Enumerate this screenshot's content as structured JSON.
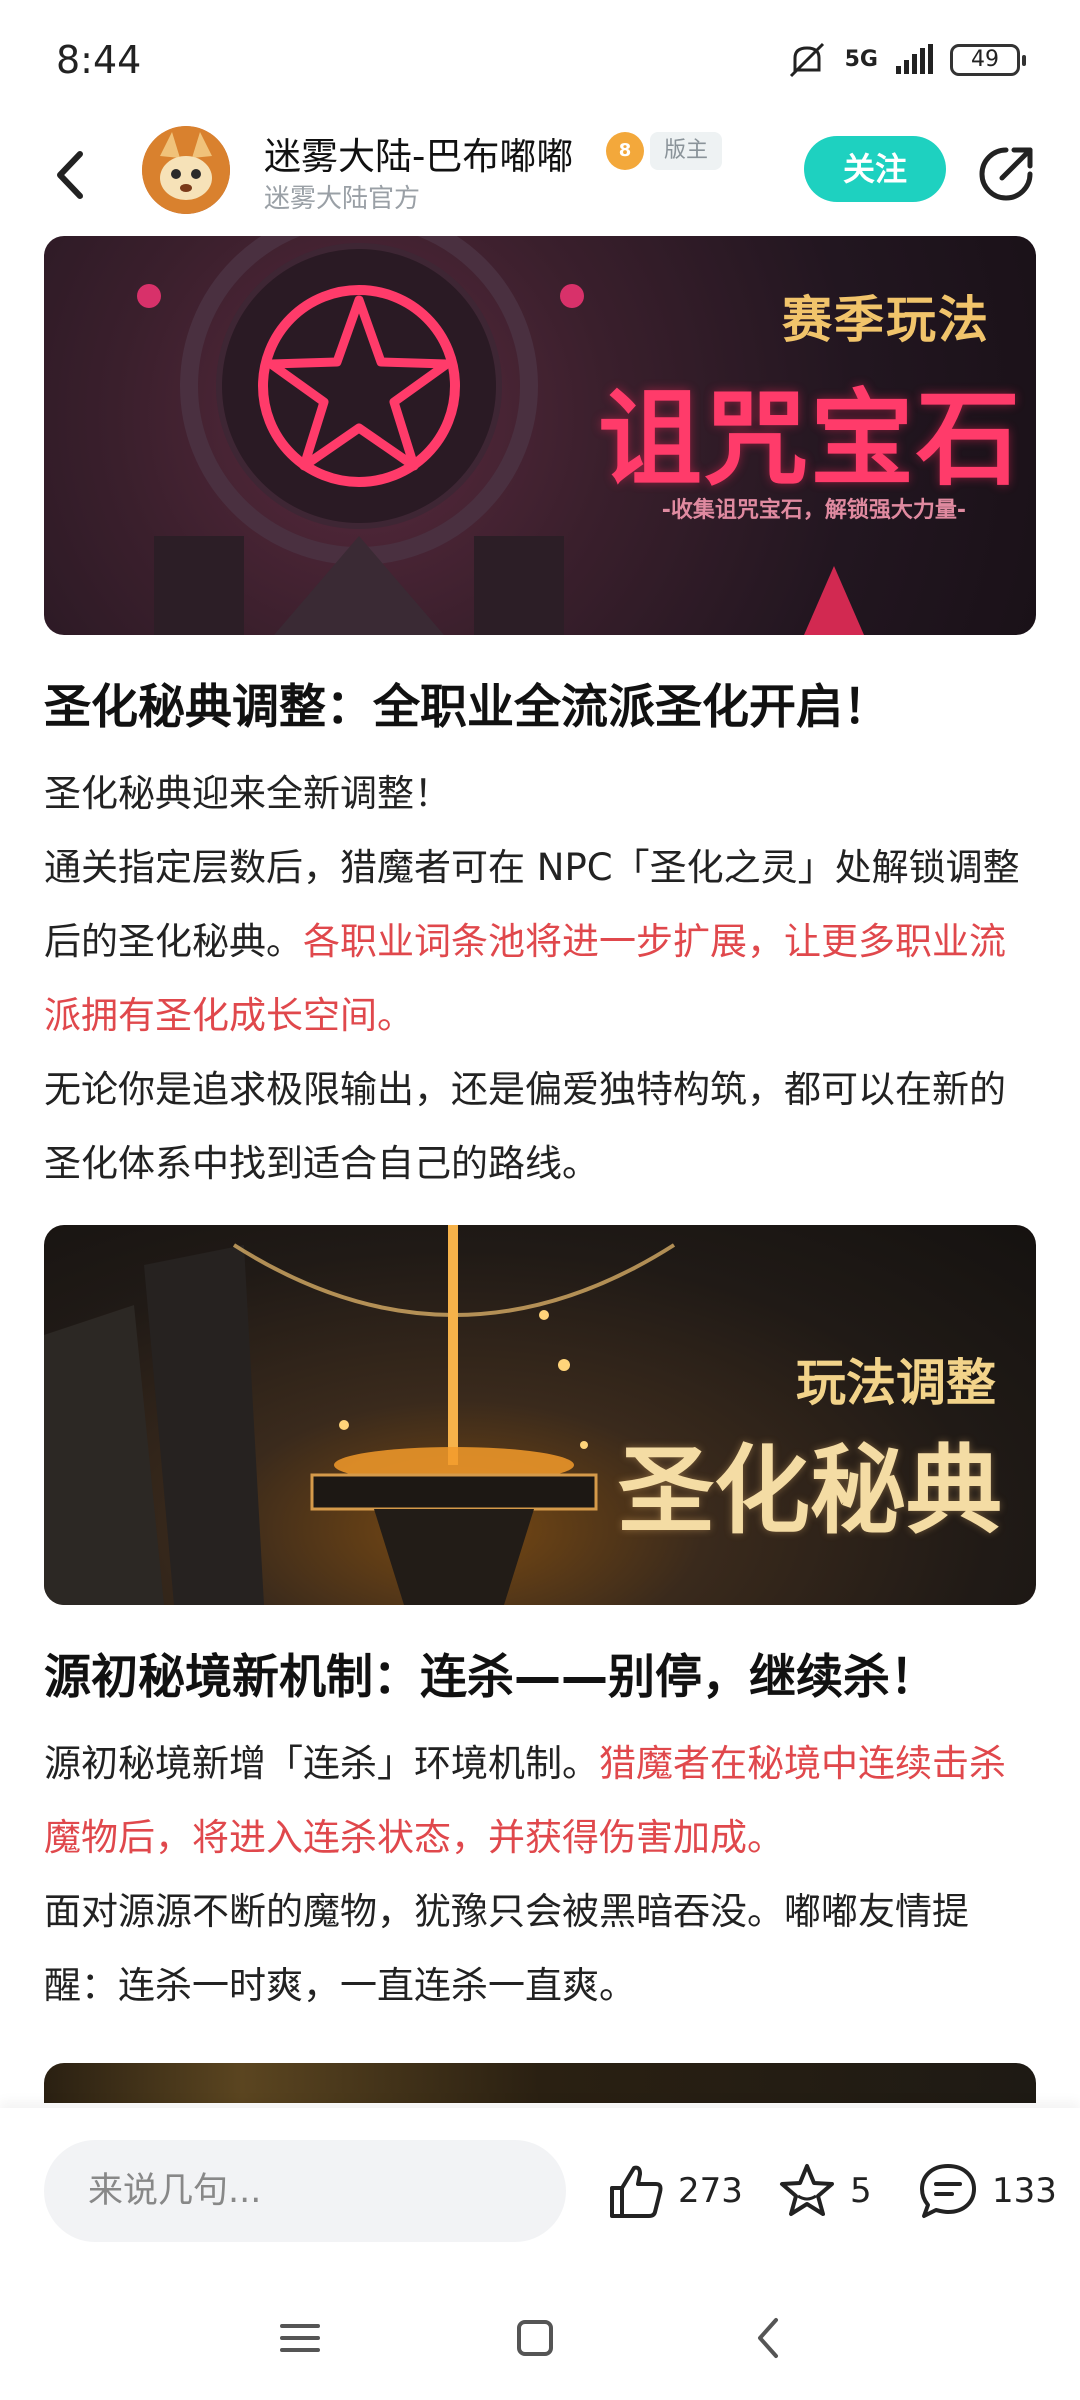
{
  "status_bar": {
    "time": "8:44",
    "network": "5G",
    "battery": "49"
  },
  "header": {
    "author_name": "迷雾大陆-巴布嘟嘟",
    "medal_level": "8",
    "role_badge": "版主",
    "author_subtitle": "迷雾大陆官方",
    "follow_label": "关注"
  },
  "banner1": {
    "tag": "赛季玩法",
    "title": "诅咒宝石",
    "subtitle": "-收集诅咒宝石，解锁强大力量-"
  },
  "section1": {
    "title": "圣化秘典调整：全职业全流派圣化开启！",
    "p1": "圣化秘典迎来全新调整！",
    "p2_plain": "通关指定层数后，猎魔者可在 NPC「圣化之灵」处解锁调整后的圣化秘典。",
    "p2_red": "各职业词条池将进一步扩展，让更多职业流派拥有圣化成长空间。",
    "p3": "无论你是追求极限输出，还是偏爱独特构筑，都可以在新的圣化体系中找到适合自己的路线。"
  },
  "banner2": {
    "tag": "玩法调整",
    "title": "圣化秘典"
  },
  "section2": {
    "title": "源初秘境新机制：连杀——别停，继续杀！",
    "p1_plain": "源初秘境新增「连杀」环境机制。",
    "p1_red": "猎魔者在秘境中连续击杀魔物后，将进入连杀状态，并获得伤害加成。",
    "p2": "面对源源不断的魔物，犹豫只会被黑暗吞没。嘟嘟友情提醒：连杀一时爽，一直连杀一直爽。"
  },
  "bottom_bar": {
    "comment_placeholder": "来说几句...",
    "like_count": "273",
    "favorite_count": "5",
    "comment_count": "133"
  },
  "colors": {
    "accent": "#1ed1c0",
    "highlight_red": "#e0484c"
  },
  "icons": [
    "back-arrow-icon",
    "share-icon",
    "thumbs-up-icon",
    "star-icon",
    "comment-icon",
    "menu-icon",
    "home-icon",
    "nav-back-icon"
  ]
}
